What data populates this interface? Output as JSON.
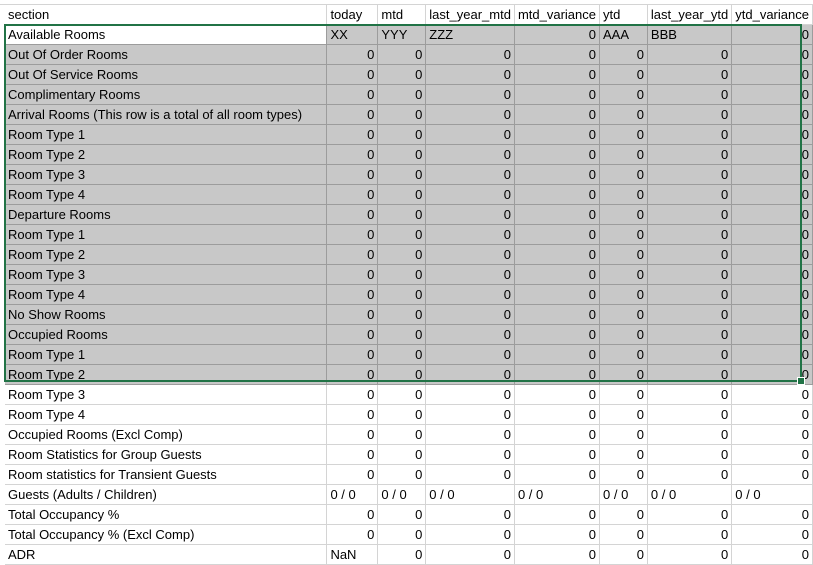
{
  "header": [
    "section",
    "today",
    "mtd",
    "last_year_mtd",
    "mtd_variance",
    "ytd",
    "last_year_ytd",
    "ytd_variance"
  ],
  "rows": [
    {
      "cells": [
        "Available Rooms",
        "XX",
        "YYY",
        "ZZZ",
        "0",
        "AAA",
        "BBB",
        "0"
      ],
      "selected": true,
      "white_first": true
    },
    {
      "cells": [
        "Out Of Order Rooms",
        "0",
        "0",
        "0",
        "0",
        "0",
        "0",
        "0"
      ],
      "selected": true
    },
    {
      "cells": [
        "Out Of Service Rooms",
        "0",
        "0",
        "0",
        "0",
        "0",
        "0",
        "0"
      ],
      "selected": true
    },
    {
      "cells": [
        "Complimentary Rooms",
        "0",
        "0",
        "0",
        "0",
        "0",
        "0",
        "0"
      ],
      "selected": true
    },
    {
      "cells": [
        "Arrival Rooms  (This row is a total of all room types)",
        "0",
        "0",
        "0",
        "0",
        "0",
        "0",
        "0"
      ],
      "selected": true
    },
    {
      "cells": [
        " Room Type 1",
        "0",
        "0",
        "0",
        "0",
        "0",
        "0",
        "0"
      ],
      "selected": true
    },
    {
      "cells": [
        " Room Type 2",
        "0",
        "0",
        "0",
        "0",
        "0",
        "0",
        "0"
      ],
      "selected": true
    },
    {
      "cells": [
        " Room Type 3",
        "0",
        "0",
        "0",
        "0",
        "0",
        "0",
        "0"
      ],
      "selected": true
    },
    {
      "cells": [
        " Room Type 4",
        "0",
        "0",
        "0",
        "0",
        "0",
        "0",
        "0"
      ],
      "selected": true
    },
    {
      "cells": [
        "Departure Rooms",
        "0",
        "0",
        "0",
        "0",
        "0",
        "0",
        "0"
      ],
      "selected": true
    },
    {
      "cells": [
        " Room Type 1",
        "0",
        "0",
        "0",
        "0",
        "0",
        "0",
        "0"
      ],
      "selected": true
    },
    {
      "cells": [
        " Room Type 2",
        "0",
        "0",
        "0",
        "0",
        "0",
        "0",
        "0"
      ],
      "selected": true
    },
    {
      "cells": [
        " Room Type 3",
        "0",
        "0",
        "0",
        "0",
        "0",
        "0",
        "0"
      ],
      "selected": true
    },
    {
      "cells": [
        " Room Type 4",
        "0",
        "0",
        "0",
        "0",
        "0",
        "0",
        "0"
      ],
      "selected": true
    },
    {
      "cells": [
        "No Show Rooms",
        "0",
        "0",
        "0",
        "0",
        "0",
        "0",
        "0"
      ],
      "selected": true
    },
    {
      "cells": [
        "Occupied Rooms",
        "0",
        "0",
        "0",
        "0",
        "0",
        "0",
        "0"
      ],
      "selected": true
    },
    {
      "cells": [
        " Room Type 1",
        "0",
        "0",
        "0",
        "0",
        "0",
        "0",
        "0"
      ],
      "selected": true
    },
    {
      "cells": [
        " Room Type 2",
        "0",
        "0",
        "0",
        "0",
        "0",
        "0",
        "0"
      ],
      "selected": true
    },
    {
      "cells": [
        " Room Type 3",
        "0",
        "0",
        "0",
        "0",
        "0",
        "0",
        "0"
      ],
      "selected": false
    },
    {
      "cells": [
        " Room Type 4",
        "0",
        "0",
        "0",
        "0",
        "0",
        "0",
        "0"
      ],
      "selected": false
    },
    {
      "cells": [
        "Occupied Rooms (Excl Comp)",
        "0",
        "0",
        "0",
        "0",
        "0",
        "0",
        "0"
      ],
      "selected": false
    },
    {
      "cells": [
        "Room Statistics for Group Guests",
        "0",
        "0",
        "0",
        "0",
        "0",
        "0",
        "0"
      ],
      "selected": false
    },
    {
      "cells": [
        "Room statistics for Transient Guests",
        "0",
        "0",
        "0",
        "0",
        "0",
        "0",
        "0"
      ],
      "selected": false
    },
    {
      "cells": [
        "Guests (Adults / Children)",
        "0 / 0",
        "0 / 0",
        "0 / 0",
        "0 / 0",
        "0 / 0",
        "0 / 0",
        "0 / 0"
      ],
      "selected": false
    },
    {
      "cells": [
        "Total Occupancy %",
        "0",
        "0",
        "0",
        "0",
        "0",
        "0",
        "0"
      ],
      "selected": false
    },
    {
      "cells": [
        "Total Occupancy % (Excl Comp)",
        "0",
        "0",
        "0",
        "0",
        "0",
        "0",
        "0"
      ],
      "selected": false
    },
    {
      "cells": [
        "ADR",
        "NaN",
        "0",
        "0",
        "0",
        "0",
        "0",
        "0"
      ],
      "selected": false
    }
  ],
  "colors": {
    "selection_fill": "#c8c8c8",
    "selection_border": "#217346",
    "gridline": "#d4d4d4"
  }
}
